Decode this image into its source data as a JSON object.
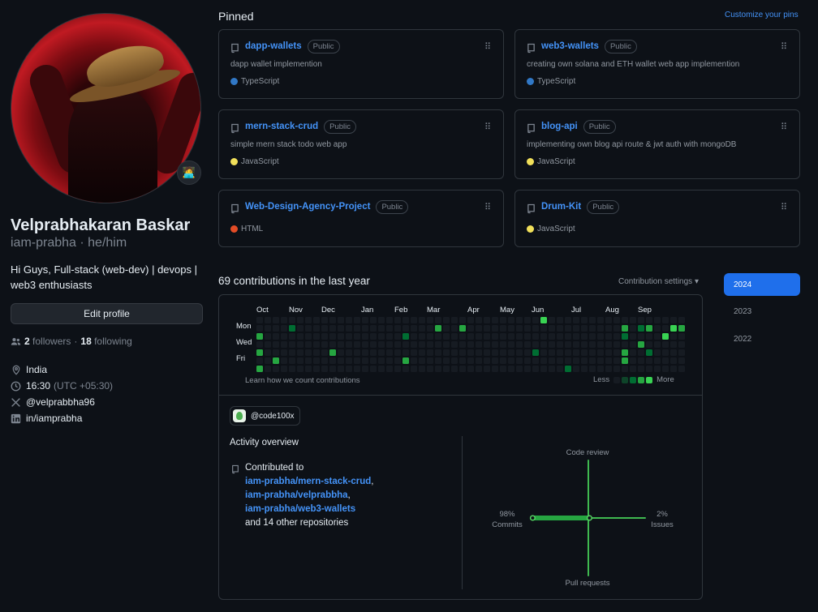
{
  "profile": {
    "name": "Velprabhakaran Baskar",
    "login_line": "iam-prabha · he/him",
    "bio": "Hi Guys, Full-stack (web-dev) | devops | web3 enthusiasts",
    "status_emoji": "🧑‍💻",
    "edit_label": "Edit profile",
    "followers_count": "2",
    "followers_label": "followers",
    "separator": "·",
    "following_count": "18",
    "following_label": "following",
    "location": "India",
    "local_time": "16:30",
    "timezone": "(UTC +05:30)",
    "twitter": "@velprabbha96",
    "linkedin": "in/iamprabha"
  },
  "pinned": {
    "title": "Pinned",
    "customize_label": "Customize your pins",
    "repos": [
      {
        "name": "dapp-wallets",
        "visibility": "Public",
        "description": "dapp wallet implemention",
        "language": "TypeScript",
        "language_color": "#3178c6"
      },
      {
        "name": "web3-wallets",
        "visibility": "Public",
        "description": "creating own solana and ETH wallet web app implemention",
        "language": "TypeScript",
        "language_color": "#3178c6"
      },
      {
        "name": "mern-stack-crud",
        "visibility": "Public",
        "description": "simple mern stack todo web app",
        "language": "JavaScript",
        "language_color": "#f1e05a"
      },
      {
        "name": "blog-api",
        "visibility": "Public",
        "description": "implementing own blog api route & jwt auth with mongoDB",
        "language": "JavaScript",
        "language_color": "#f1e05a"
      },
      {
        "name": "Web-Design-Agency-Project",
        "visibility": "Public",
        "description": "",
        "language": "HTML",
        "language_color": "#e34c26"
      },
      {
        "name": "Drum-Kit",
        "visibility": "Public",
        "description": "",
        "language": "JavaScript",
        "language_color": "#f1e05a"
      }
    ]
  },
  "contributions": {
    "title": "69 contributions in the last year",
    "settings_label": "Contribution settings ▾",
    "months": [
      "Oct",
      "Nov",
      "Dec",
      "Jan",
      "Feb",
      "Mar",
      "Apr",
      "May",
      "Jun",
      "Jul",
      "Aug",
      "Sep"
    ],
    "weekdays": [
      "Mon",
      "Wed",
      "Fri"
    ],
    "learn_label": "Learn how we count contributions",
    "less_label": "Less",
    "more_label": "More",
    "level_colors": [
      "#161b22",
      "#0e4429",
      "#006d32",
      "#26a641",
      "#39d353"
    ],
    "active_cells": [
      {
        "week": 0,
        "day": 2,
        "level": 3
      },
      {
        "week": 0,
        "day": 4,
        "level": 3
      },
      {
        "week": 0,
        "day": 6,
        "level": 3
      },
      {
        "week": 2,
        "day": 5,
        "level": 3
      },
      {
        "week": 4,
        "day": 1,
        "level": 2
      },
      {
        "week": 9,
        "day": 4,
        "level": 3
      },
      {
        "week": 18,
        "day": 2,
        "level": 2
      },
      {
        "week": 18,
        "day": 5,
        "level": 3
      },
      {
        "week": 22,
        "day": 1,
        "level": 3
      },
      {
        "week": 25,
        "day": 1,
        "level": 3
      },
      {
        "week": 34,
        "day": 4,
        "level": 2
      },
      {
        "week": 35,
        "day": 0,
        "level": 4
      },
      {
        "week": 38,
        "day": 6,
        "level": 2
      },
      {
        "week": 45,
        "day": 1,
        "level": 3
      },
      {
        "week": 45,
        "day": 2,
        "level": 2
      },
      {
        "week": 45,
        "day": 4,
        "level": 3
      },
      {
        "week": 45,
        "day": 5,
        "level": 3
      },
      {
        "week": 47,
        "day": 1,
        "level": 2
      },
      {
        "week": 47,
        "day": 3,
        "level": 3
      },
      {
        "week": 48,
        "day": 1,
        "level": 3
      },
      {
        "week": 48,
        "day": 4,
        "level": 2
      },
      {
        "week": 50,
        "day": 2,
        "level": 4
      },
      {
        "week": 51,
        "day": 1,
        "level": 4
      },
      {
        "week": 52,
        "day": 1,
        "level": 3
      }
    ]
  },
  "activity": {
    "org_handle": "@code100x",
    "title": "Activity overview",
    "contributed_to": "Contributed to",
    "repos": [
      "iam-prabha/mern-stack-crud",
      "iam-prabha/velprabbha",
      "iam-prabha/web3-wallets"
    ],
    "others": "and 14 other repositories",
    "axes": {
      "code_review": "Code review",
      "commits_pct": "98%",
      "commits": "Commits",
      "issues_pct": "2%",
      "issues": "Issues",
      "pull_requests": "Pull requests"
    },
    "commits_share": 0.98,
    "issues_share": 0.02
  },
  "years": [
    "2024",
    "2023",
    "2022"
  ]
}
